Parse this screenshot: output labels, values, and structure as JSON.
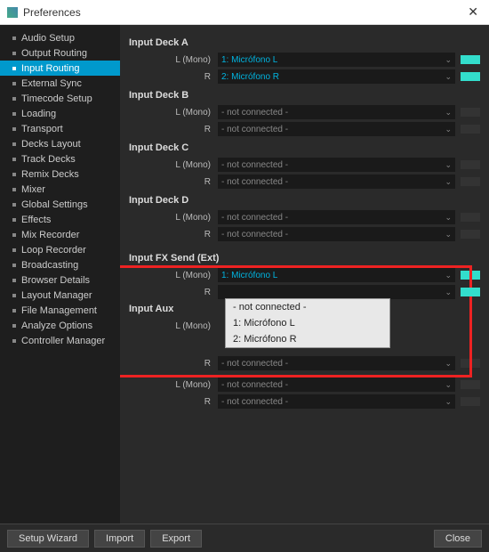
{
  "window": {
    "title": "Preferences"
  },
  "sidebar": {
    "items": [
      {
        "label": "Audio Setup"
      },
      {
        "label": "Output Routing"
      },
      {
        "label": "Input Routing",
        "active": true
      },
      {
        "label": "External Sync"
      },
      {
        "label": "Timecode Setup"
      },
      {
        "label": "Loading"
      },
      {
        "label": "Transport"
      },
      {
        "label": "Decks Layout"
      },
      {
        "label": "Track Decks"
      },
      {
        "label": "Remix Decks"
      },
      {
        "label": "Mixer"
      },
      {
        "label": "Global Settings"
      },
      {
        "label": "Effects"
      },
      {
        "label": "Mix Recorder"
      },
      {
        "label": "Loop Recorder"
      },
      {
        "label": "Broadcasting"
      },
      {
        "label": "Browser Details"
      },
      {
        "label": "Layout Manager"
      },
      {
        "label": "File Management"
      },
      {
        "label": "Analyze Options"
      },
      {
        "label": "Controller Manager"
      }
    ]
  },
  "labels": {
    "l_mono": "L (Mono)",
    "r": "R",
    "not_connected": "- not connected -"
  },
  "sections": {
    "deck_a": {
      "title": "Input Deck A",
      "l": "1: Micrófono L",
      "r": "2: Micrófono R"
    },
    "deck_b": {
      "title": "Input Deck B",
      "l": "- not connected -",
      "r": "- not connected -"
    },
    "deck_c": {
      "title": "Input Deck C",
      "l": "- not connected -",
      "r": "- not connected -"
    },
    "deck_d": {
      "title": "Input Deck D",
      "l": "- not connected -",
      "r": "- not connected -"
    },
    "fx_send": {
      "title": "Input FX Send (Ext)",
      "l": "1: Micrófono L",
      "r": ""
    },
    "aux": {
      "title": "Input Aux",
      "l": "",
      "r": "- not connected -"
    },
    "extra": {
      "l": "- not connected -",
      "r": "- not connected -"
    }
  },
  "dropdown": {
    "items": [
      "- not connected -",
      "1: Micrófono L",
      "2: Micrófono R"
    ]
  },
  "footer": {
    "setup_wizard": "Setup Wizard",
    "import": "Import",
    "export": "Export",
    "close": "Close"
  }
}
